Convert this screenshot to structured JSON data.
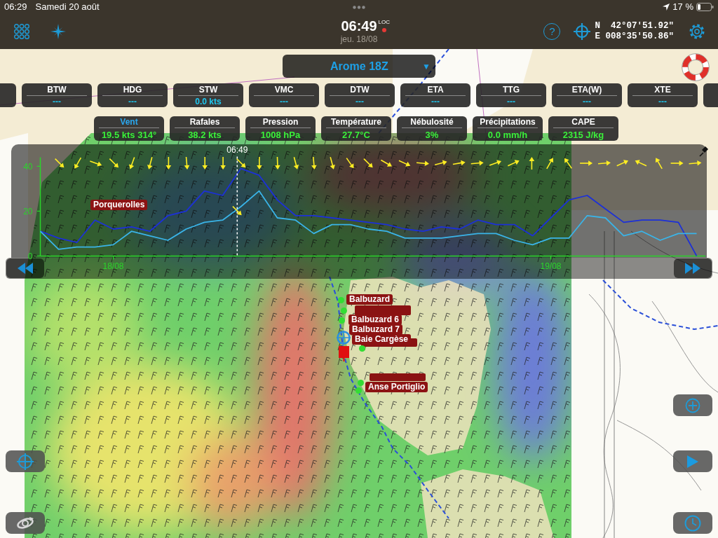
{
  "status_bar": {
    "time": "06:29",
    "date": "Samedi 20 août",
    "battery": "17 %"
  },
  "toolbar": {
    "help": "?",
    "time": "06:49",
    "time_reference": "LOC",
    "date": "jeu. 18/08",
    "latitude": "N  42°07'51.92\"",
    "longitude": "E 008°35'50.86\""
  },
  "model_selector": {
    "label": "Arome 18Z",
    "arrow": "▼"
  },
  "instruments": [
    {
      "kind": "cut"
    },
    {
      "kind": "reading",
      "label": "BTW",
      "value": "---"
    },
    {
      "kind": "reading",
      "label": "HDG",
      "value": "---"
    },
    {
      "kind": "reading",
      "label": "STW",
      "value": "0.0 kts"
    },
    {
      "kind": "reading",
      "label": "VMC",
      "value": "---"
    },
    {
      "kind": "reading",
      "label": "DTW",
      "value": "---"
    },
    {
      "kind": "reading",
      "label": "ETA",
      "value": "---"
    },
    {
      "kind": "reading",
      "label": "TTG",
      "value": "---"
    },
    {
      "kind": "reading",
      "label": "ETA(W)",
      "value": "---"
    },
    {
      "kind": "reading",
      "label": "XTE",
      "value": "---"
    },
    {
      "kind": "cut"
    }
  ],
  "weather": [
    {
      "label": "Vent",
      "value": "19.5 kts 314°",
      "selected": true
    },
    {
      "label": "Rafales",
      "value": "38.2 kts",
      "selected": false
    },
    {
      "label": "Pression",
      "value": "1008 hPa",
      "selected": false
    },
    {
      "label": "Température",
      "value": "27.7°C",
      "selected": false
    },
    {
      "label": "Nébulosité",
      "value": "3%",
      "selected": false
    },
    {
      "label": "Précipitations",
      "value": "0.0 mm/h",
      "selected": false
    },
    {
      "label": "CAPE",
      "value": "2315 J/kg",
      "selected": false
    }
  ],
  "forecast_chart": {
    "chart_data": {
      "type": "line",
      "categories": [
        null,
        null,
        null,
        null,
        "18/08",
        null,
        null,
        null,
        null,
        null,
        null,
        null,
        null,
        null,
        null,
        null,
        null,
        null,
        null,
        null,
        null,
        null,
        null,
        null,
        null,
        null,
        null,
        null,
        "19/08",
        null,
        null,
        null,
        null,
        null,
        null,
        null,
        null
      ],
      "ylim": [
        0,
        44
      ],
      "yticks": [
        0,
        20,
        40
      ],
      "series": [
        {
          "color": "#1c30d8",
          "values": [
            11,
            8,
            6,
            16,
            12,
            13,
            11,
            18,
            20,
            29,
            27,
            39,
            36,
            25,
            18,
            18,
            17,
            16,
            15,
            14,
            12,
            11,
            13,
            12,
            16,
            14,
            14,
            9,
            17,
            25,
            27,
            21,
            15,
            16,
            16,
            15,
            0
          ]
        },
        {
          "color": "#3ab4e8",
          "values": [
            11,
            3,
            4,
            4,
            5,
            11,
            9,
            7,
            12,
            15,
            16,
            22,
            29,
            17,
            16,
            10,
            14,
            14,
            12,
            11,
            8,
            8,
            8,
            9,
            10,
            10,
            7,
            5,
            8,
            8,
            18,
            17,
            9,
            11,
            7,
            10,
            10
          ]
        }
      ],
      "annotations": [
        "06:49"
      ]
    }
  },
  "waypoints": [
    {
      "label": "Porquerolles"
    },
    {
      "label": "Balbuzard"
    },
    {
      "label": "Balbuzard 6"
    },
    {
      "label": "Balbuzard 7"
    },
    {
      "label": "Baie Cargèse"
    },
    {
      "label": "Anse Portiglio"
    }
  ]
}
